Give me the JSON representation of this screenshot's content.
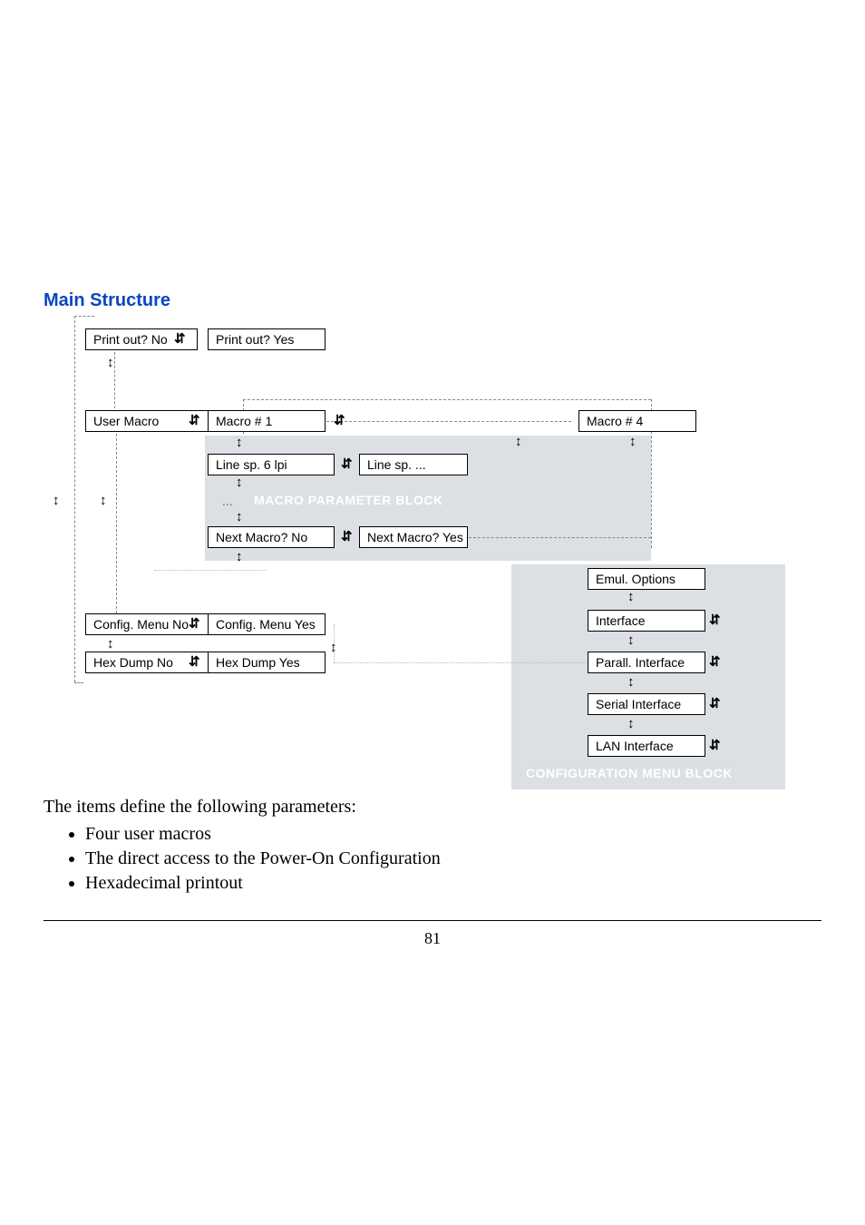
{
  "heading": "Main Structure",
  "diagram": {
    "printout_no": "Print out? No",
    "printout_yes": "Print out? Yes",
    "user_macro": "User Macro",
    "macro1": "Macro # 1",
    "macro4": "Macro # 4",
    "linesp6": "Line sp. 6 lpi",
    "linesp": "Line sp. ...",
    "ellipsis": "...",
    "macro_block": "MACRO PARAMETER BLOCK",
    "nextmacro_no": "Next Macro? No",
    "nextmacro_yes": "Next Macro? Yes",
    "config_no": "Config. Menu No",
    "config_yes": "Config. Menu  Yes",
    "hex_no": "Hex Dump No",
    "hex_yes": "Hex Dump  Yes",
    "emul": "Emul. Options",
    "interface": "Interface",
    "parall": "Parall. Interface",
    "serial": "Serial Interface",
    "lan": "LAN Interface",
    "config_block": "CONFIGURATION MENU BLOCK"
  },
  "intro": "The items define the following parameters:",
  "bullets": [
    "Four user macros",
    "The direct access to the Power-On Configuration",
    "Hexadecimal printout"
  ],
  "page_number": "81"
}
